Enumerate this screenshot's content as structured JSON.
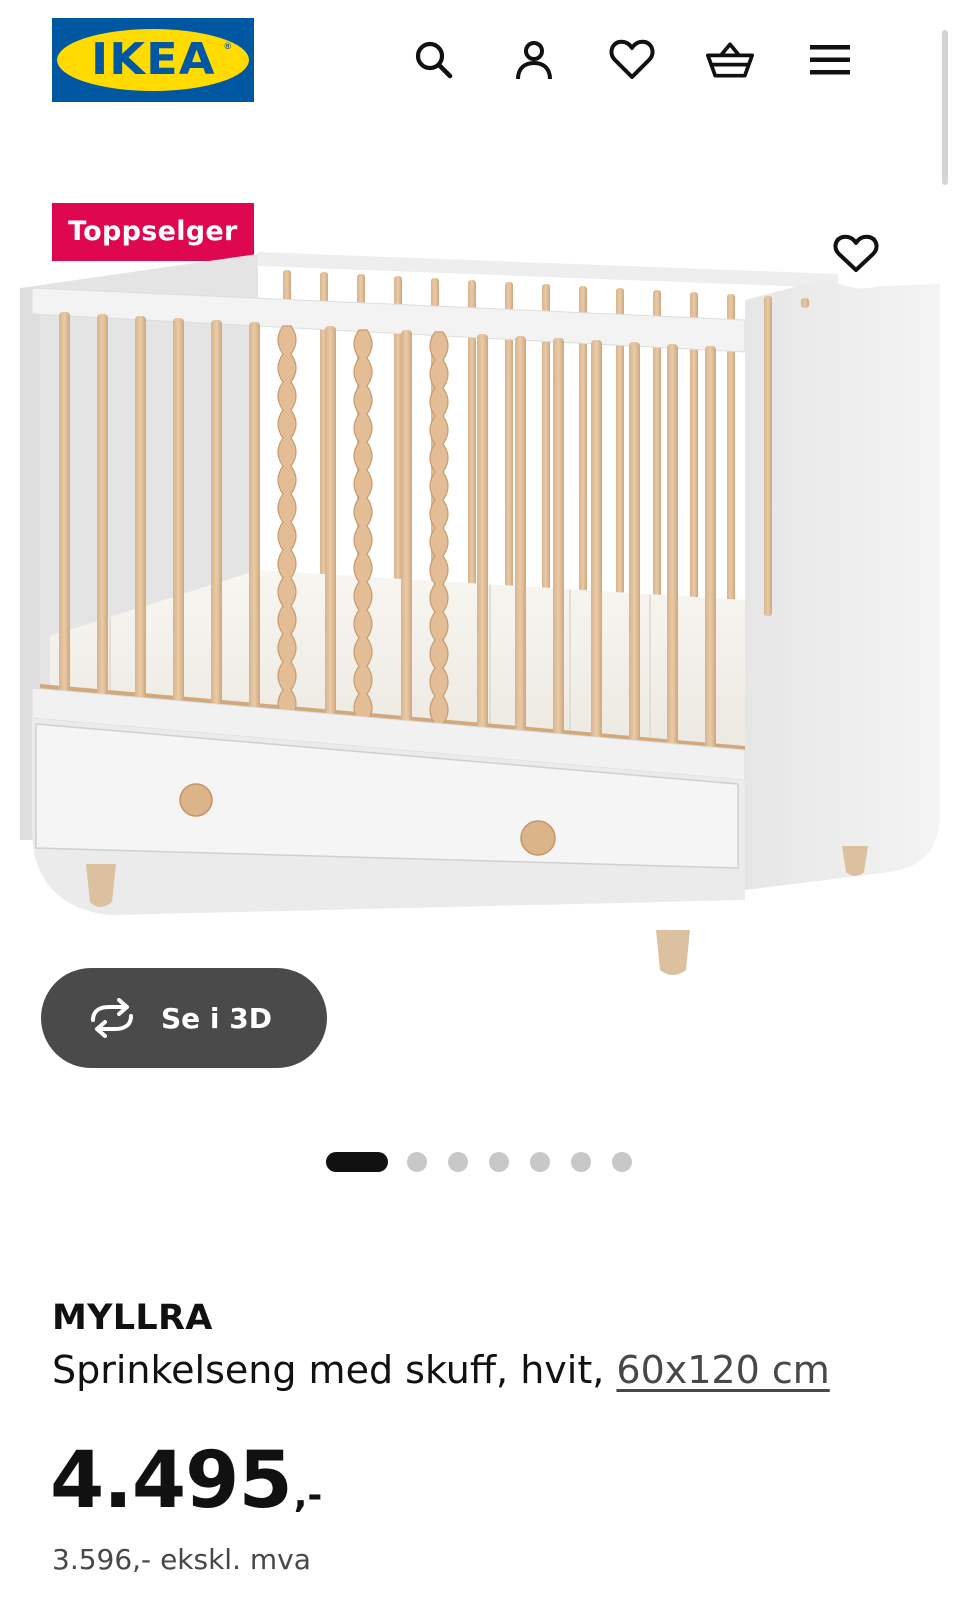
{
  "header": {
    "logo_text": "IKEA",
    "logo_reg": "®",
    "icons": [
      "search-icon",
      "account-icon",
      "favourites-icon",
      "basket-icon",
      "menu-icon"
    ]
  },
  "gallery": {
    "badge": "Toppselger",
    "view_3d_label": "Se i 3D",
    "dots_total": 7,
    "dots_active_index": 0
  },
  "product": {
    "name": "MYLLRA",
    "description": "Sprinkelseng med skuff, hvit, ",
    "size": "60x120 cm",
    "price": "4.495",
    "price_suffix": ",-",
    "price_excl": "3.596,- ekskl. mva"
  },
  "colors": {
    "ikea_blue": "#0058a3",
    "ikea_yellow": "#ffdb00",
    "badge_red": "#e00751",
    "button_grey": "#4a4a4a"
  }
}
